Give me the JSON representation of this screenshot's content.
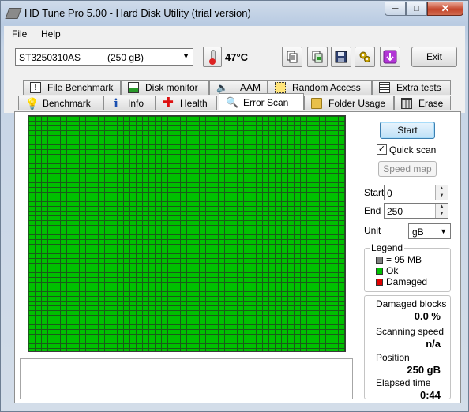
{
  "window": {
    "title": "HD Tune Pro 5.00 - Hard Disk Utility (trial version)"
  },
  "menu": {
    "file": "File",
    "help": "Help"
  },
  "toolbar": {
    "drive_model": "ST3250310AS",
    "drive_size": "(250 gB)",
    "temperature": "47°C",
    "exit_label": "Exit",
    "icons": [
      "copy-text-icon",
      "copy-screenshot-icon",
      "save-icon",
      "options-icon",
      "download-icon"
    ]
  },
  "tabs": {
    "row1": [
      "File Benchmark",
      "Disk monitor",
      "AAM",
      "Random Access",
      "Extra tests"
    ],
    "row2": [
      "Benchmark",
      "Info",
      "Health",
      "Error Scan",
      "Folder Usage",
      "Erase"
    ],
    "active": "Error Scan"
  },
  "error_scan": {
    "start_button": "Start",
    "quick_scan_label": "Quick scan",
    "quick_scan_checked": true,
    "speed_map_button": "Speed map",
    "start_label": "Start",
    "start_value": "0",
    "end_label": "End",
    "end_value": "250",
    "unit_label": "Unit",
    "unit_value": "gB",
    "legend": {
      "title": "Legend",
      "block_size": "= 95 MB",
      "ok": "Ok",
      "damaged": "Damaged",
      "colors": {
        "block": "#808080",
        "ok": "#00c000",
        "damaged": "#e00000"
      }
    },
    "stats": {
      "damaged_blocks_label": "Damaged blocks",
      "damaged_blocks_value": "0.0 %",
      "scanning_speed_label": "Scanning speed",
      "scanning_speed_value": "n/a",
      "position_label": "Position",
      "position_value": "250 gB",
      "elapsed_label": "Elapsed time",
      "elapsed_value": "0:44"
    }
  }
}
